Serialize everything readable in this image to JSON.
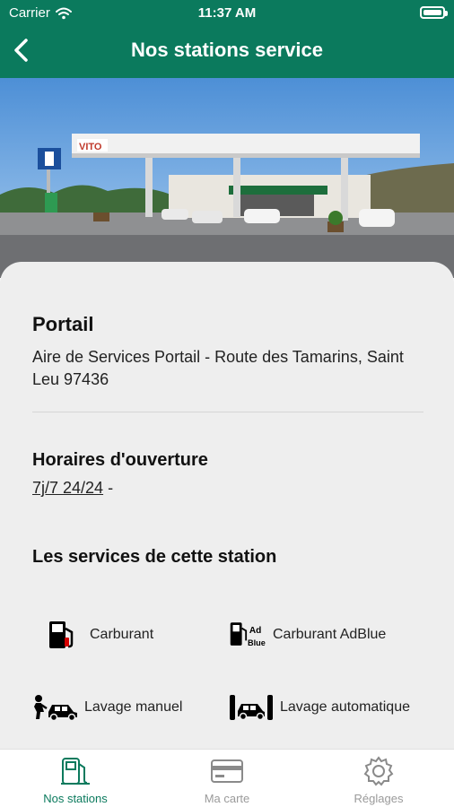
{
  "status_bar": {
    "carrier": "Carrier",
    "time": "11:37 AM"
  },
  "header": {
    "title": "Nos stations service",
    "back_icon": "chevron-left-icon"
  },
  "station": {
    "name": "Portail",
    "address": "Aire de Services Portail - Route des Tamarins, Saint Leu 97436",
    "photo_sign": "VITO"
  },
  "hours": {
    "title": "Horaires d'ouverture",
    "value": "7j/7 24/24",
    "suffix": "-"
  },
  "services": {
    "title": "Les services de cette station",
    "items": [
      {
        "label": "Carburant",
        "icon": "fuel-pump-icon"
      },
      {
        "label": "Carburant AdBlue",
        "icon": "adblue-pump-icon"
      },
      {
        "label": "Lavage manuel",
        "icon": "manual-wash-icon"
      },
      {
        "label": "Lavage automatique",
        "icon": "automatic-wash-icon"
      }
    ],
    "adblue_text_top": "Ad",
    "adblue_text_bottom": "Blue"
  },
  "tabs": [
    {
      "label": "Nos stations",
      "icon": "fuel-station-icon",
      "active": true
    },
    {
      "label": "Ma carte",
      "icon": "card-icon",
      "active": false
    },
    {
      "label": "Réglages",
      "icon": "gear-icon",
      "active": false
    }
  ],
  "colors": {
    "brand": "#0b7a5d",
    "sheet": "#eeeeee",
    "inactive": "#9a9a9a"
  }
}
